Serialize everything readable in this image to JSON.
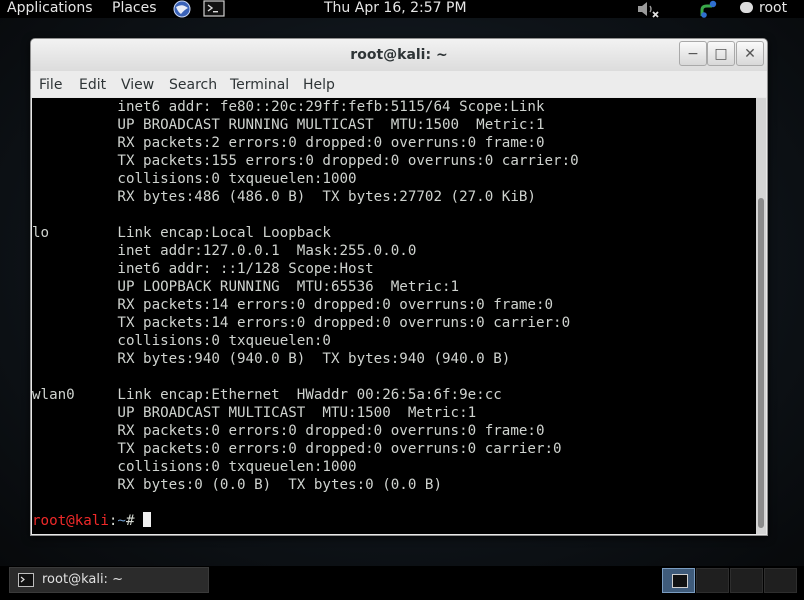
{
  "top_panel": {
    "applications": "Applications",
    "places": "Places",
    "clock": "Thu Apr 16,  2:57 PM",
    "user": "root",
    "icons": [
      "browser-icon",
      "terminal-icon",
      "volume-muted-icon",
      "network-icon",
      "chat-icon"
    ]
  },
  "window": {
    "title": "root@kali: ~",
    "buttons": {
      "minimize": "−",
      "maximize": "□",
      "close": "✕"
    },
    "menu": [
      "File",
      "Edit",
      "View",
      "Search",
      "Terminal",
      "Help"
    ]
  },
  "terminal": {
    "lines": [
      "          inet6 addr: fe80::20c:29ff:fefb:5115/64 Scope:Link",
      "          UP BROADCAST RUNNING MULTICAST  MTU:1500  Metric:1",
      "          RX packets:2 errors:0 dropped:0 overruns:0 frame:0",
      "          TX packets:155 errors:0 dropped:0 overruns:0 carrier:0",
      "          collisions:0 txqueuelen:1000",
      "          RX bytes:486 (486.0 B)  TX bytes:27702 (27.0 KiB)",
      "",
      "lo        Link encap:Local Loopback",
      "          inet addr:127.0.0.1  Mask:255.0.0.0",
      "          inet6 addr: ::1/128 Scope:Host",
      "          UP LOOPBACK RUNNING  MTU:65536  Metric:1",
      "          RX packets:14 errors:0 dropped:0 overruns:0 frame:0",
      "          TX packets:14 errors:0 dropped:0 overruns:0 carrier:0",
      "          collisions:0 txqueuelen:0",
      "          RX bytes:940 (940.0 B)  TX bytes:940 (940.0 B)",
      "",
      "wlan0     Link encap:Ethernet  HWaddr 00:26:5a:6f:9e:cc",
      "          UP BROADCAST MULTICAST  MTU:1500  Metric:1",
      "          RX packets:0 errors:0 dropped:0 overruns:0 frame:0",
      "          TX packets:0 errors:0 dropped:0 overruns:0 carrier:0",
      "          collisions:0 txqueuelen:1000",
      "          RX bytes:0 (0.0 B)  TX bytes:0 (0.0 B)",
      ""
    ],
    "prompt": {
      "user": "root@kali",
      "sep": ":",
      "path": "~",
      "symbol": "# "
    }
  },
  "taskbar": {
    "item_label": "root@kali: ~",
    "workspace_count": 4,
    "active_workspace": 1
  }
}
